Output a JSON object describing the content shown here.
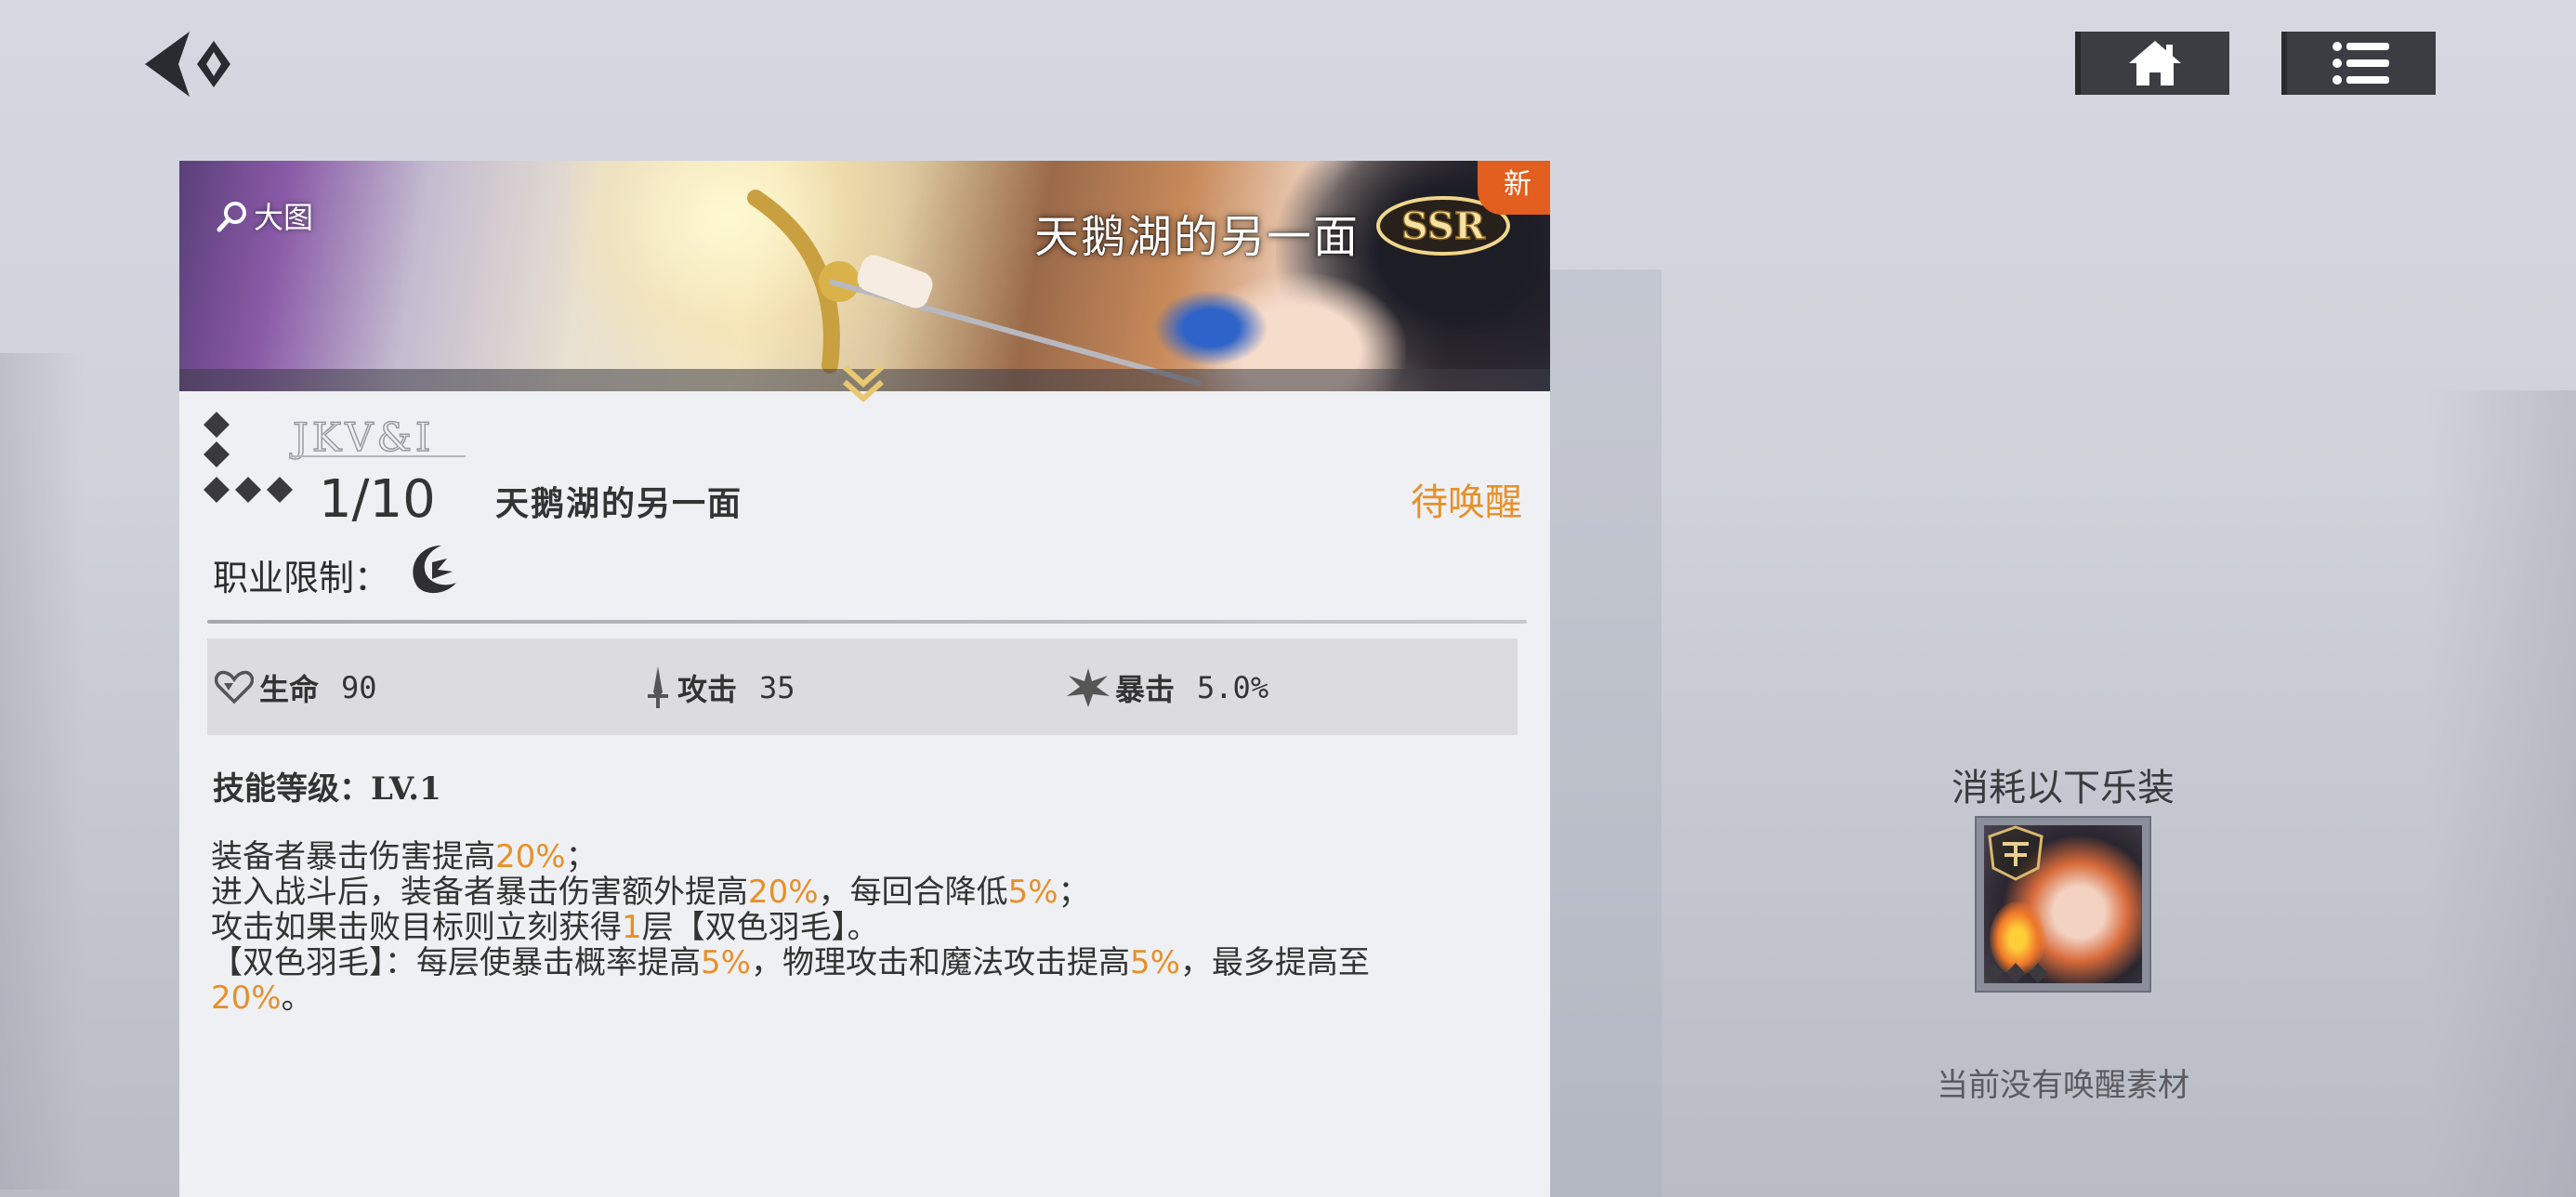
{
  "nav": {
    "back_icon": "back-arrow-icon",
    "home_icon": "home-icon",
    "menu_icon": "list-menu-icon"
  },
  "item": {
    "banner_title": "天鹅湖的另一面",
    "rarity": "SSR",
    "new_badge": "新",
    "zoom_label": "大图",
    "level_progress": "1/10",
    "name": "天鹅湖的另一面",
    "awaken_status": "待唤醒",
    "job_label": "职业限制：",
    "job_icon": "crescent-class-icon",
    "signature_text": "JKV&I"
  },
  "stats": [
    {
      "icon": "heart-icon",
      "label": "生命",
      "value": "90"
    },
    {
      "icon": "dagger-icon",
      "label": "攻击",
      "value": "35"
    },
    {
      "icon": "critical-burst-icon",
      "label": "暴击",
      "value": "5.0%"
    }
  ],
  "skill": {
    "level_text": "技能等级：LV.1",
    "lines": [
      [
        {
          "t": "装备者暴击伤害提高"
        },
        {
          "t": "20%",
          "hl": true
        },
        {
          "t": "；"
        }
      ],
      [
        {
          "t": "进入战斗后，装备者暴击伤害额外提高"
        },
        {
          "t": "20%",
          "hl": true
        },
        {
          "t": "，每回合降低"
        },
        {
          "t": "5%",
          "hl": true
        },
        {
          "t": "；"
        }
      ],
      [
        {
          "t": "攻击如果击败目标则立刻获得"
        },
        {
          "t": "1",
          "hl": true
        },
        {
          "t": "层【双色羽毛】。"
        }
      ],
      [
        {
          "t": "【双色羽毛】：每层使暴击概率提高"
        },
        {
          "t": "5%",
          "hl": true
        },
        {
          "t": "，物理攻击和魔法攻击提高"
        },
        {
          "t": "5%",
          "hl": true
        },
        {
          "t": "，最多提高至"
        }
      ],
      [
        {
          "t": "20%",
          "hl": true
        },
        {
          "t": "。"
        }
      ]
    ]
  },
  "awaken_panel": {
    "consume_title": "消耗以下乐装",
    "empty_text": "当前没有唤醒素材"
  },
  "colors": {
    "accent_orange": "#e6902a",
    "new_badge": "#e25f1f",
    "dark_button": "#3b3d42"
  }
}
